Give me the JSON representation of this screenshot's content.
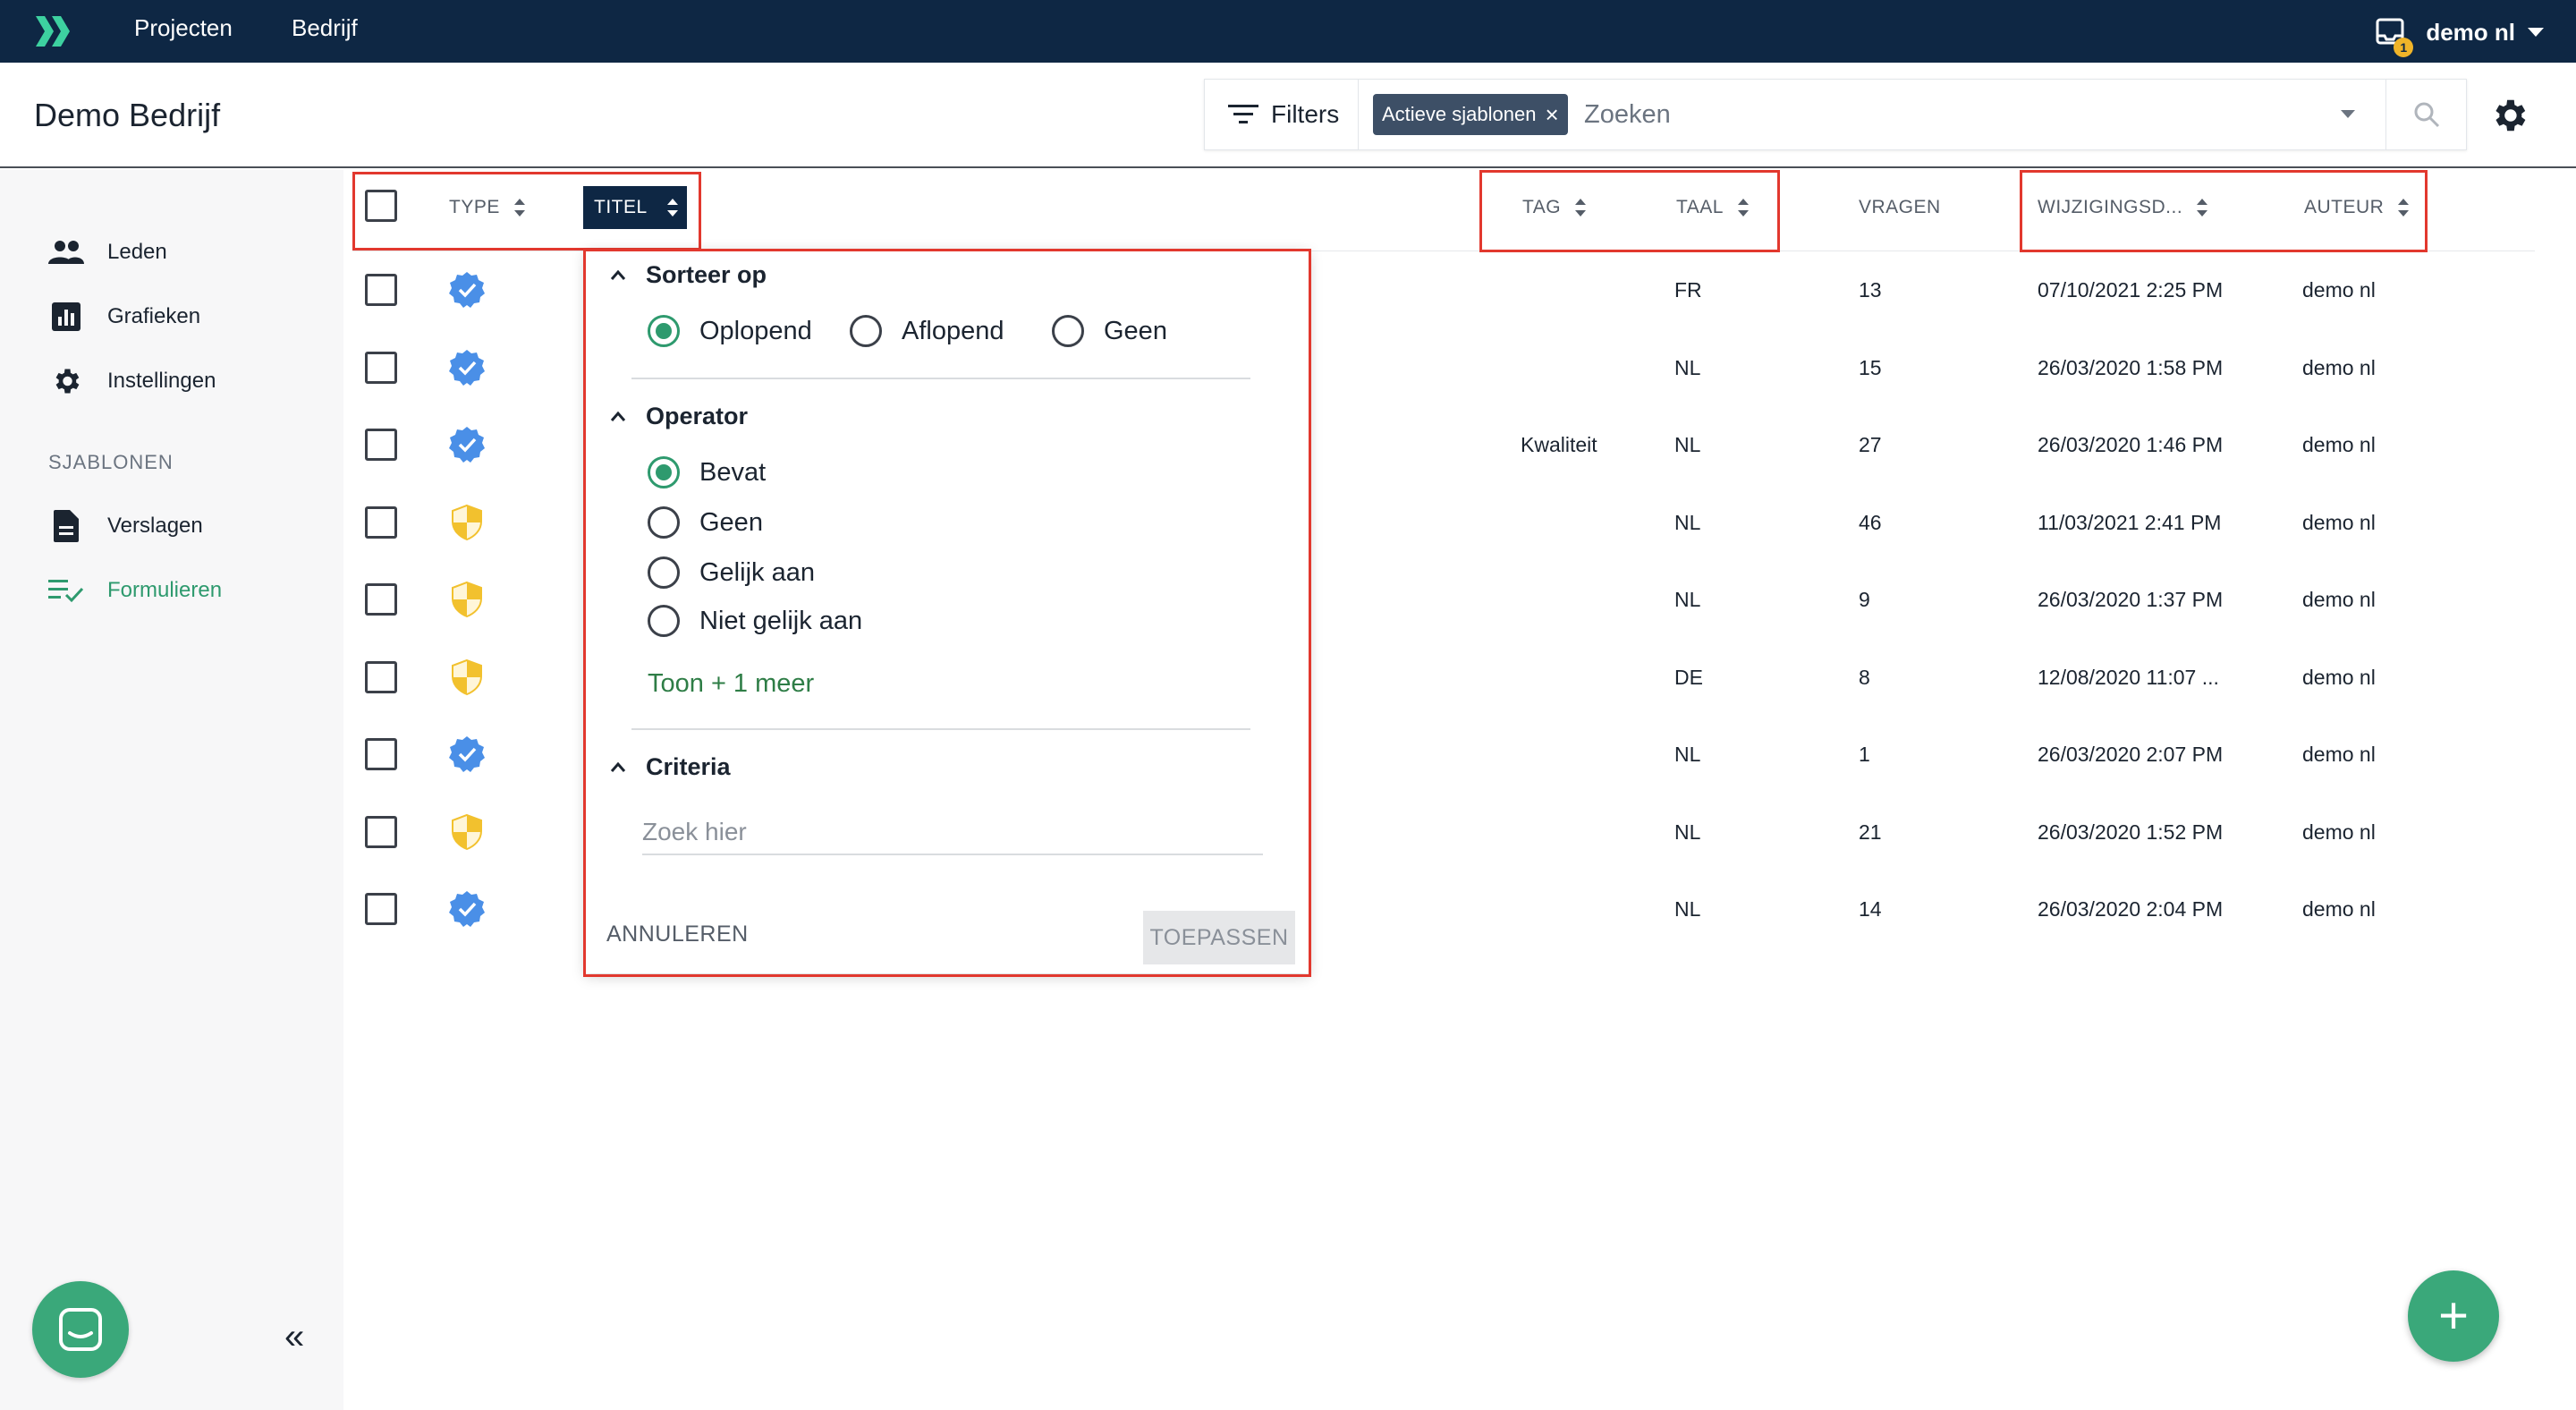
{
  "topnav": {
    "links": [
      "Projecten",
      "Bedrijf"
    ],
    "user_name": "demo nl",
    "inbox_count": "1"
  },
  "header": {
    "title": "Demo Bedrijf",
    "filters_label": "Filters",
    "active_chip": "Actieve sjablonen",
    "search_placeholder": "Zoeken"
  },
  "sidebar": {
    "items": [
      {
        "label": "Leden",
        "icon": "people-icon"
      },
      {
        "label": "Grafieken",
        "icon": "bar-chart-icon"
      },
      {
        "label": "Instellingen",
        "icon": "gear-icon"
      }
    ],
    "section_label": "SJABLONEN",
    "section_items": [
      {
        "label": "Verslagen",
        "icon": "document-icon"
      },
      {
        "label": "Formulieren",
        "icon": "checklist-icon",
        "active": true
      }
    ]
  },
  "table": {
    "columns": {
      "type": "TYPE",
      "titel": "TITEL",
      "tag": "TAG",
      "taal": "TAAL",
      "vragen": "VRAGEN",
      "wijziging": "WIJZIGINGSD...",
      "auteur": "AUTEUR"
    },
    "rows": [
      {
        "type": "verified",
        "tag": "",
        "taal": "FR",
        "vragen": "13",
        "datum": "07/10/2021 2:25 PM",
        "auteur": "demo nl"
      },
      {
        "type": "verified",
        "tag": "",
        "taal": "NL",
        "vragen": "15",
        "datum": "26/03/2020 1:58 PM",
        "auteur": "demo nl"
      },
      {
        "type": "verified",
        "tag": "Kwaliteit",
        "taal": "NL",
        "vragen": "27",
        "datum": "26/03/2020 1:46 PM",
        "auteur": "demo nl"
      },
      {
        "type": "shield",
        "tag": "",
        "taal": "NL",
        "vragen": "46",
        "datum": "11/03/2021 2:41 PM",
        "auteur": "demo nl"
      },
      {
        "type": "shield",
        "tag": "",
        "taal": "NL",
        "vragen": "9",
        "datum": "26/03/2020 1:37 PM",
        "auteur": "demo nl"
      },
      {
        "type": "shield",
        "tag": "",
        "taal": "DE",
        "vragen": "8",
        "datum": "12/08/2020 11:07 ...",
        "auteur": "demo nl"
      },
      {
        "type": "verified",
        "tag": "",
        "taal": "NL",
        "vragen": "1",
        "datum": "26/03/2020 2:07 PM",
        "auteur": "demo nl"
      },
      {
        "type": "shield",
        "tag": "",
        "taal": "NL",
        "vragen": "21",
        "datum": "26/03/2020 1:52 PM",
        "auteur": "demo nl"
      },
      {
        "type": "verified",
        "tag": "",
        "taal": "NL",
        "vragen": "14",
        "datum": "26/03/2020 2:04 PM",
        "auteur": "demo nl"
      }
    ]
  },
  "popup": {
    "sort_title": "Sorteer op",
    "sort_options": [
      "Oplopend",
      "Aflopend",
      "Geen"
    ],
    "sort_selected": "Oplopend",
    "operator_title": "Operator",
    "operator_options": [
      "Bevat",
      "Geen",
      "Gelijk aan",
      "Niet gelijk aan"
    ],
    "operator_selected": "Bevat",
    "show_more": "Toon + 1 meer",
    "criteria_title": "Criteria",
    "criteria_placeholder": "Zoek hier",
    "cancel_label": "ANNULEREN",
    "apply_label": "TOEPASSEN"
  },
  "fab_label": "+",
  "colors": {
    "nav_bg": "#0e2744",
    "accent_green": "#2e9a6e",
    "highlight_red": "#e2382e",
    "verified_blue": "#4a8fe7",
    "shield_yellow": "#f2c12e"
  }
}
